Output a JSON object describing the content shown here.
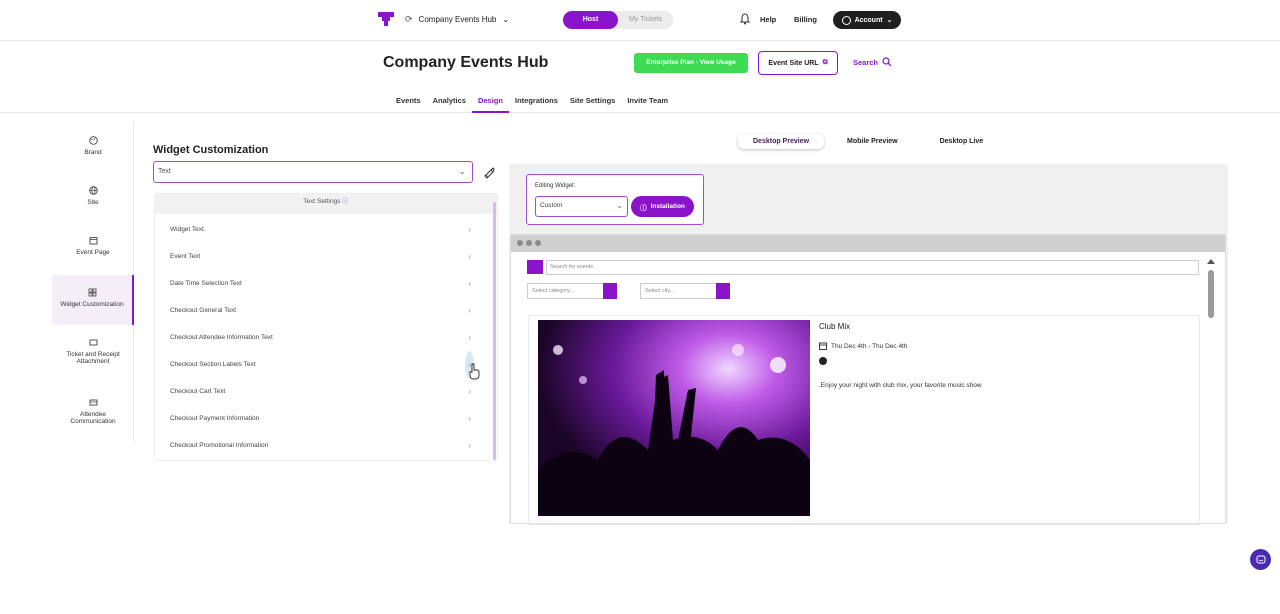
{
  "topbar": {
    "org_name": "Company Events Hub",
    "org_sync_icon": "sync-icon",
    "mode_host": "Host",
    "mode_tickets": "My Tickets",
    "help": "Help",
    "billing": "Billing",
    "account": "Account"
  },
  "header": {
    "title": "Company Events Hub",
    "plan_button": "Enterprise Plan - View Usage",
    "url_button": "Event Site URL",
    "search": "Search"
  },
  "tabs": [
    "Events",
    "Analytics",
    "Design",
    "Integrations",
    "Site Settings",
    "Invite Team"
  ],
  "active_tab": "Design",
  "sidebar": {
    "items": [
      {
        "label": "Brand",
        "icon": "palette-icon"
      },
      {
        "label": "Site",
        "icon": "globe-icon"
      },
      {
        "label": "Event Page",
        "icon": "calendar-icon"
      },
      {
        "label": "Widget Customization",
        "icon": "widget-icon"
      },
      {
        "label": "Ticket and Receipt Attachment",
        "icon": "ticket-icon"
      },
      {
        "label": "Attendee Communication",
        "icon": "mail-icon"
      }
    ]
  },
  "widget_customization": {
    "title": "Widget Customization",
    "selected": "Text",
    "settings_header": "Text Settings",
    "rows": [
      "Widget Text",
      "Event Text",
      "Date Time Selection Text",
      "Checkout General Text",
      "Checkout Attendee Information Text",
      "Checkout Section Labels Text",
      "Checkout Cart Text",
      "Checkout Payment Information",
      "Checkout Promotional Information"
    ]
  },
  "preview": {
    "tabs": [
      "Desktop Preview",
      "Mobile Preview",
      "Desktop Live"
    ],
    "active_tab": "Desktop Preview",
    "editing_label": "Editing Widget:",
    "editing_value": "Custom",
    "install_button": "Installation",
    "widget": {
      "search_placeholder": "Search for events",
      "category_placeholder": "Select category...",
      "city_placeholder": "Select city...",
      "event_name": "Club Mix",
      "event_date": "Thu Dec 4th - Thu Dec 4th",
      "event_desc": ".Enjoy your night with club mix, your favorite music show"
    }
  },
  "colors": {
    "accent": "#8a14c9",
    "plan_green": "#3ddc54",
    "chat": "#4a2bb0"
  }
}
